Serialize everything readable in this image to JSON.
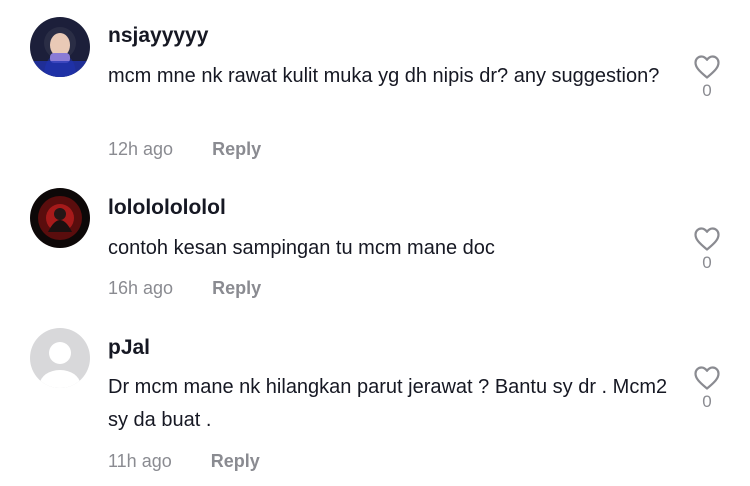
{
  "comments": [
    {
      "username": "nsjayyyyy",
      "text": "mcm mne nk rawat kulit muka yg dh nipis dr? any suggestion?",
      "time": "12h ago",
      "reply_label": "Reply",
      "likes": "0",
      "avatar_icon": "girl-hijab-avatar"
    },
    {
      "username": "lolololololol",
      "text": "contoh kesan sampingan tu mcm mane doc",
      "time": "16h ago",
      "reply_label": "Reply",
      "likes": "0",
      "avatar_icon": "dark-red-avatar"
    },
    {
      "username": "pJal",
      "text": "Dr mcm mane nk hilangkan parut jerawat ? Bantu sy dr . Mcm2 sy da buat .",
      "time": "11h ago",
      "reply_label": "Reply",
      "likes": "0",
      "avatar_icon": "default-user-avatar"
    }
  ],
  "colors": {
    "text": "#161823",
    "muted": "#8a8b91"
  }
}
